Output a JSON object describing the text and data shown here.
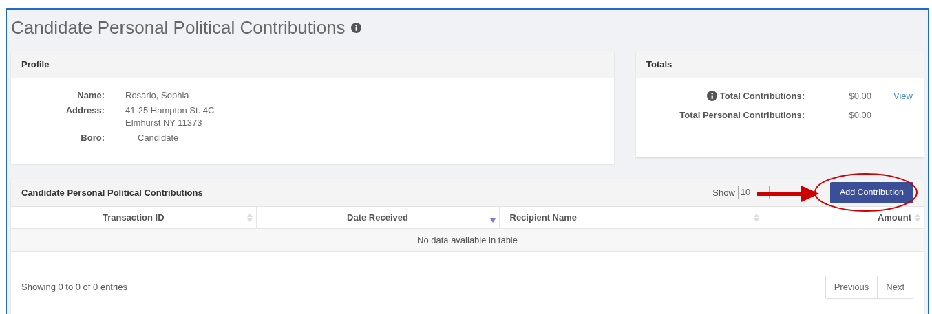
{
  "page_title": "Candidate Personal Political Contributions",
  "profile": {
    "title": "Profile",
    "fields": [
      {
        "label": "Name:",
        "lines": [
          "Rosario, Sophia"
        ],
        "indented": false
      },
      {
        "label": "Address:",
        "lines": [
          "41-25 Hampton St. 4C",
          "Elmhurst NY 11373"
        ],
        "indented": false
      },
      {
        "label": "Boro:",
        "lines": [
          "Candidate"
        ],
        "indented": true
      }
    ]
  },
  "totals": {
    "title": "Totals",
    "rows": [
      {
        "label": "Total Contributions:",
        "info": true,
        "value": "$0.00",
        "link": "View"
      },
      {
        "label": "Total Personal Contributions:",
        "info": false,
        "value": "$0.00"
      }
    ]
  },
  "table": {
    "title": "Candidate Personal Political Contributions",
    "show_label": "Show",
    "page_length": "10",
    "add_button": "Add Contribution",
    "columns": [
      {
        "label": "Transaction ID",
        "sorted": false
      },
      {
        "label": "Date Received",
        "sorted": true
      },
      {
        "label": "Recipient Name",
        "sorted": false
      },
      {
        "label": "Amount",
        "sorted": false
      }
    ],
    "empty_message": "No data available in table",
    "info": "Showing 0 to 0 of 0 entries",
    "pagination": [
      "Previous",
      "Next"
    ]
  },
  "annotation": {
    "kind": "arrow-and-circle"
  }
}
